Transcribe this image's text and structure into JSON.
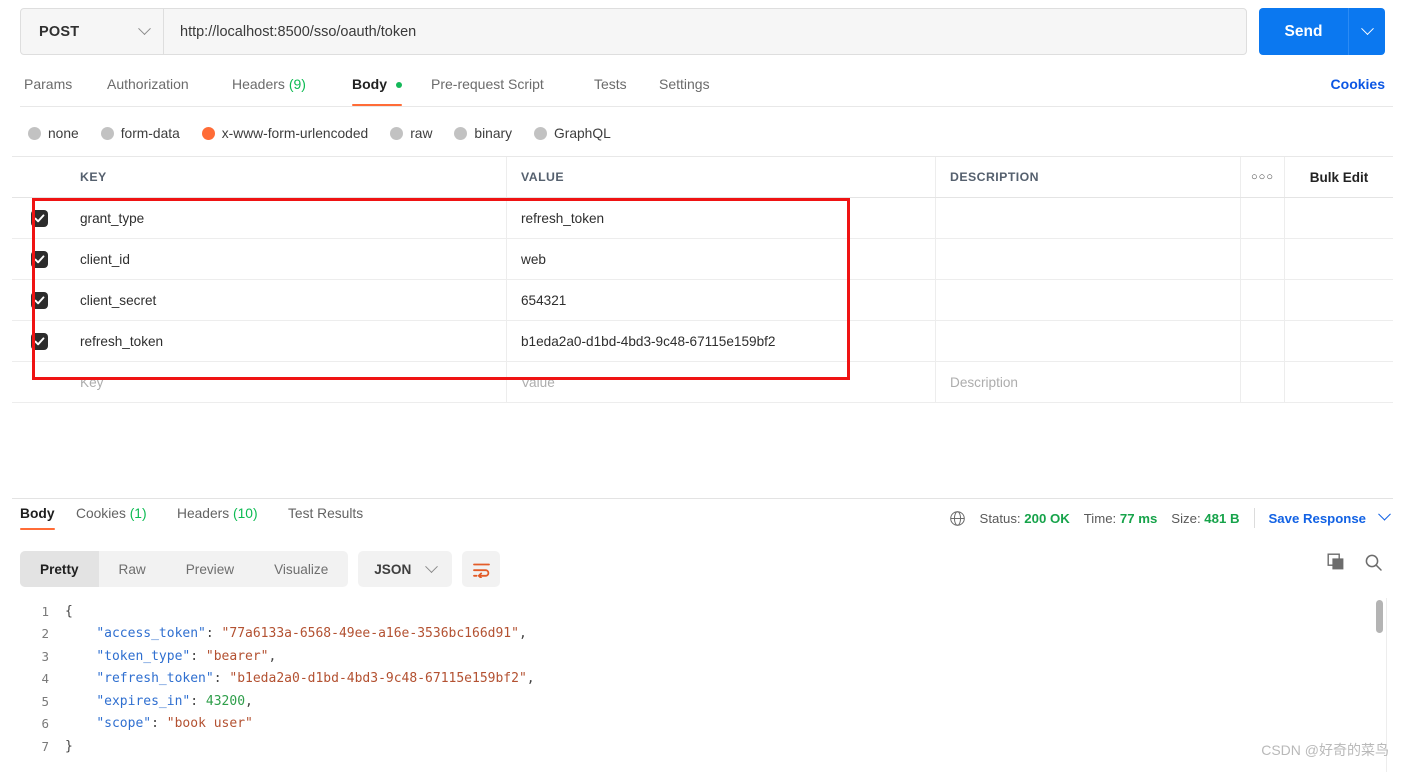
{
  "request": {
    "method": "POST",
    "url": "http://localhost:8500/sso/oauth/token",
    "send_label": "Send",
    "cookies_link": "Cookies",
    "tabs": [
      {
        "label": "Params",
        "badge": "",
        "active": false
      },
      {
        "label": "Authorization",
        "badge": "",
        "active": false
      },
      {
        "label": "Headers",
        "badge": "(9)",
        "active": false
      },
      {
        "label": "Body",
        "badge": "",
        "active": true
      },
      {
        "label": "Pre-request Script",
        "badge": "",
        "active": false
      },
      {
        "label": "Tests",
        "badge": "",
        "active": false
      },
      {
        "label": "Settings",
        "badge": "",
        "active": false
      }
    ],
    "body_types": [
      {
        "label": "none",
        "selected": false
      },
      {
        "label": "form-data",
        "selected": false
      },
      {
        "label": "x-www-form-urlencoded",
        "selected": true
      },
      {
        "label": "raw",
        "selected": false
      },
      {
        "label": "binary",
        "selected": false
      },
      {
        "label": "GraphQL",
        "selected": false
      }
    ],
    "table": {
      "headers": {
        "key": "KEY",
        "value": "VALUE",
        "description": "DESCRIPTION"
      },
      "dots_label": "○○○",
      "bulk_edit": "Bulk Edit",
      "rows": [
        {
          "checked": true,
          "key": "grant_type",
          "value": "refresh_token",
          "description": ""
        },
        {
          "checked": true,
          "key": "client_id",
          "value": "web",
          "description": ""
        },
        {
          "checked": true,
          "key": "client_secret",
          "value": "654321",
          "description": ""
        },
        {
          "checked": true,
          "key": "refresh_token",
          "value": "b1eda2a0-d1bd-4bd3-9c48-67115e159bf2",
          "description": ""
        }
      ],
      "placeholder_row": {
        "key": "Key",
        "value": "Value",
        "description": "Description"
      }
    }
  },
  "response": {
    "tabs": [
      {
        "label": "Body",
        "badge": "",
        "active": true
      },
      {
        "label": "Cookies",
        "badge": "(1)",
        "active": false
      },
      {
        "label": "Headers",
        "badge": "(10)",
        "active": false
      },
      {
        "label": "Test Results",
        "badge": "",
        "active": false
      }
    ],
    "status": {
      "status_label": "Status:",
      "status_value": "200 OK",
      "time_label": "Time:",
      "time_value": "77 ms",
      "size_label": "Size:",
      "size_value": "481 B",
      "save_response": "Save Response"
    },
    "view_modes": [
      {
        "label": "Pretty",
        "active": true
      },
      {
        "label": "Raw",
        "active": false
      },
      {
        "label": "Preview",
        "active": false
      },
      {
        "label": "Visualize",
        "active": false
      }
    ],
    "format": "JSON",
    "code_lines": [
      {
        "n": "1",
        "tokens": [
          {
            "t": "{",
            "c": "tk-punct"
          }
        ]
      },
      {
        "n": "2",
        "tokens": [
          {
            "t": "    ",
            "c": "tk-punct"
          },
          {
            "t": "\"access_token\"",
            "c": "tk-key"
          },
          {
            "t": ": ",
            "c": "tk-punct"
          },
          {
            "t": "\"77a6133a-6568-49ee-a16e-3536bc166d91\"",
            "c": "tk-str"
          },
          {
            "t": ",",
            "c": "tk-punct"
          }
        ]
      },
      {
        "n": "3",
        "tokens": [
          {
            "t": "    ",
            "c": "tk-punct"
          },
          {
            "t": "\"token_type\"",
            "c": "tk-key"
          },
          {
            "t": ": ",
            "c": "tk-punct"
          },
          {
            "t": "\"bearer\"",
            "c": "tk-str"
          },
          {
            "t": ",",
            "c": "tk-punct"
          }
        ]
      },
      {
        "n": "4",
        "tokens": [
          {
            "t": "    ",
            "c": "tk-punct"
          },
          {
            "t": "\"refresh_token\"",
            "c": "tk-key"
          },
          {
            "t": ": ",
            "c": "tk-punct"
          },
          {
            "t": "\"b1eda2a0-d1bd-4bd3-9c48-67115e159bf2\"",
            "c": "tk-str"
          },
          {
            "t": ",",
            "c": "tk-punct"
          }
        ]
      },
      {
        "n": "5",
        "tokens": [
          {
            "t": "    ",
            "c": "tk-punct"
          },
          {
            "t": "\"expires_in\"",
            "c": "tk-key"
          },
          {
            "t": ": ",
            "c": "tk-punct"
          },
          {
            "t": "43200",
            "c": "tk-num"
          },
          {
            "t": ",",
            "c": "tk-punct"
          }
        ]
      },
      {
        "n": "6",
        "tokens": [
          {
            "t": "    ",
            "c": "tk-punct"
          },
          {
            "t": "\"scope\"",
            "c": "tk-key"
          },
          {
            "t": ": ",
            "c": "tk-punct"
          },
          {
            "t": "\"book user\"",
            "c": "tk-str"
          }
        ]
      },
      {
        "n": "7",
        "tokens": [
          {
            "t": "}",
            "c": "tk-punct"
          }
        ]
      }
    ]
  },
  "watermark": "CSDN @好奇的菜鸟",
  "colors": {
    "accent_orange": "#ff6c37",
    "send_blue": "#0b78f0",
    "link_blue": "#0b56e4",
    "status_green": "#16a34a",
    "annotation_red": "#ef1313"
  }
}
